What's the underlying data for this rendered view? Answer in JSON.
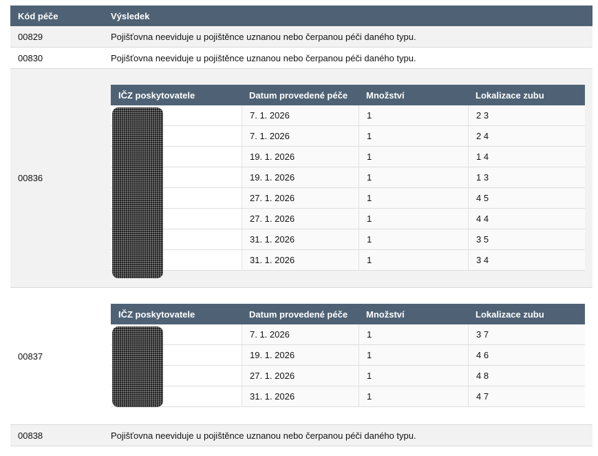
{
  "table": {
    "headers": {
      "code": "Kód péče",
      "result": "Výsledek"
    },
    "rows": [
      {
        "code": "00829",
        "result": "Pojišťovna neeviduje u pojištěnce uznanou nebo čerpanou péči daného typu."
      },
      {
        "code": "00830",
        "result": "Pojišťovna neeviduje u pojištěnce uznanou nebo čerpanou péči daného typu."
      },
      {
        "code": "00836",
        "details": [
          {
            "date": "7. 1. 2026",
            "qty": "1",
            "tooth": "2 3"
          },
          {
            "date": "7. 1. 2026",
            "qty": "1",
            "tooth": "2 4"
          },
          {
            "date": "19. 1. 2026",
            "qty": "1",
            "tooth": "1 4"
          },
          {
            "date": "19. 1. 2026",
            "qty": "1",
            "tooth": "1 3"
          },
          {
            "date": "27. 1. 2026",
            "qty": "1",
            "tooth": "4 5"
          },
          {
            "date": "27. 1. 2026",
            "qty": "1",
            "tooth": "4 4"
          },
          {
            "date": "31. 1. 2026",
            "qty": "1",
            "tooth": "3 5"
          },
          {
            "date": "31. 1. 2026",
            "qty": "1",
            "tooth": "3 4"
          }
        ]
      },
      {
        "code": "00837",
        "details": [
          {
            "date": "7. 1. 2026",
            "qty": "1",
            "tooth": "3 7"
          },
          {
            "date": "19. 1. 2026",
            "qty": "1",
            "tooth": "4 6"
          },
          {
            "date": "27. 1. 2026",
            "qty": "1",
            "tooth": "4 8"
          },
          {
            "date": "31. 1. 2026",
            "qty": "1",
            "tooth": "4 7"
          }
        ]
      },
      {
        "code": "00838",
        "result": "Pojišťovna neeviduje u pojištěnce uznanou nebo čerpanou péči daného typu."
      }
    ]
  },
  "subtable_headers": {
    "icz": "IČZ poskytovatele",
    "date": "Datum provedené péče",
    "qty": "Množství",
    "tooth": "Lokalizace zubu"
  },
  "colors": {
    "header_bg": "#4f6275",
    "row_shade": "#f2f2f2"
  }
}
